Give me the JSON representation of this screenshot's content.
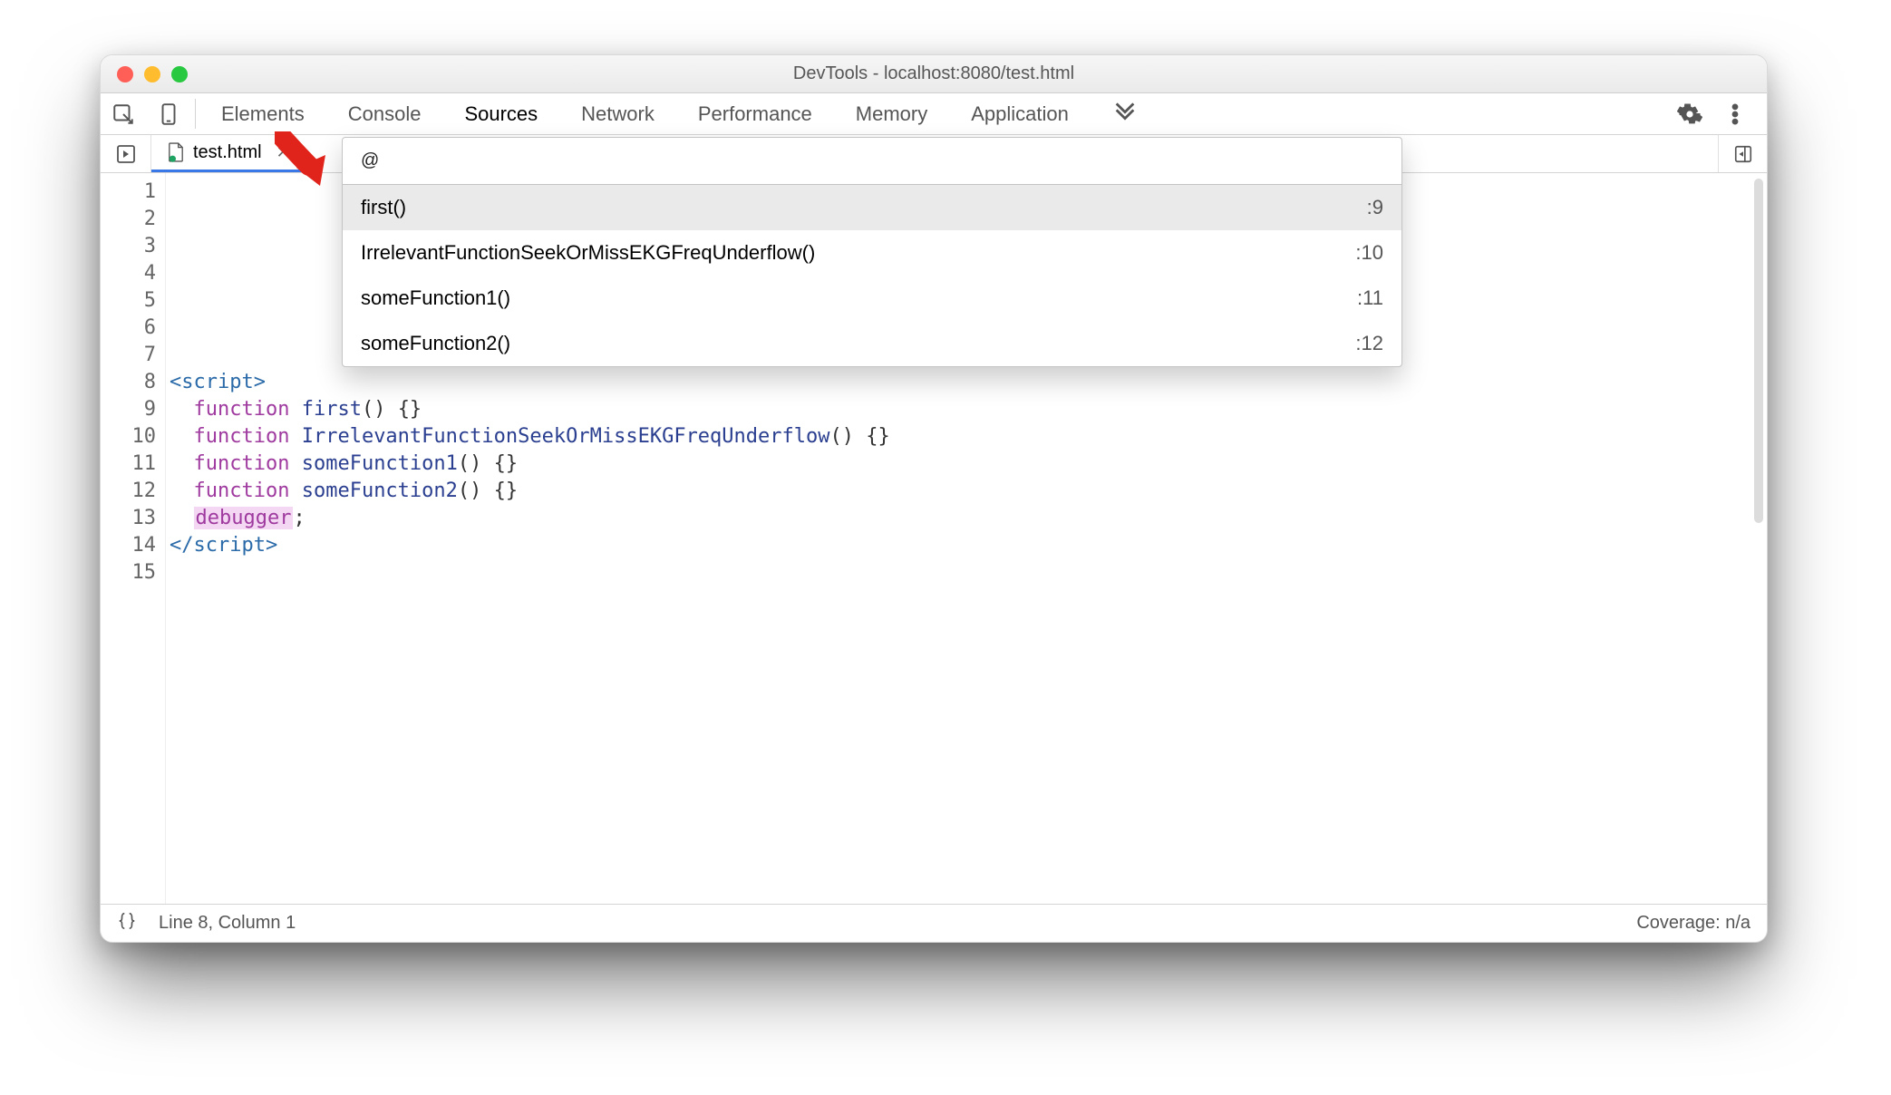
{
  "window": {
    "title": "DevTools - localhost:8080/test.html"
  },
  "tabs": {
    "items": [
      "Elements",
      "Console",
      "Sources",
      "Network",
      "Performance",
      "Memory",
      "Application"
    ],
    "active": "Sources"
  },
  "file_tab": {
    "name": "test.html"
  },
  "popup": {
    "query": "@",
    "rows": [
      {
        "label": "first()",
        "line": ":9"
      },
      {
        "label": "IrrelevantFunctionSeekOrMissEKGFreqUnderflow()",
        "line": ":10"
      },
      {
        "label": "someFunction1()",
        "line": ":11"
      },
      {
        "label": "someFunction2()",
        "line": ":12"
      }
    ],
    "selectedIndex": 0
  },
  "code": {
    "lines": [
      {
        "n": 1,
        "tokens": []
      },
      {
        "n": 2,
        "tokens": []
      },
      {
        "n": 3,
        "tokens": []
      },
      {
        "n": 4,
        "tokens": []
      },
      {
        "n": 5,
        "tokens": []
      },
      {
        "n": 6,
        "tokens": []
      },
      {
        "n": 7,
        "tokens": []
      },
      {
        "n": 8,
        "tokens": [
          {
            "t": "<script>",
            "c": "tag"
          }
        ]
      },
      {
        "n": 9,
        "tokens": [
          {
            "t": "  ",
            "c": ""
          },
          {
            "t": "function",
            "c": "kw"
          },
          {
            "t": " ",
            "c": ""
          },
          {
            "t": "first",
            "c": "fn"
          },
          {
            "t": "() {}",
            "c": "punc"
          }
        ]
      },
      {
        "n": 10,
        "tokens": [
          {
            "t": "  ",
            "c": ""
          },
          {
            "t": "function",
            "c": "kw"
          },
          {
            "t": " ",
            "c": ""
          },
          {
            "t": "IrrelevantFunctionSeekOrMissEKGFreqUnderflow",
            "c": "fn"
          },
          {
            "t": "() {}",
            "c": "punc"
          }
        ]
      },
      {
        "n": 11,
        "tokens": [
          {
            "t": "  ",
            "c": ""
          },
          {
            "t": "function",
            "c": "kw"
          },
          {
            "t": " ",
            "c": ""
          },
          {
            "t": "someFunction1",
            "c": "fn"
          },
          {
            "t": "() {}",
            "c": "punc"
          }
        ]
      },
      {
        "n": 12,
        "tokens": [
          {
            "t": "  ",
            "c": ""
          },
          {
            "t": "function",
            "c": "kw"
          },
          {
            "t": " ",
            "c": ""
          },
          {
            "t": "someFunction2",
            "c": "fn"
          },
          {
            "t": "() {}",
            "c": "punc"
          }
        ]
      },
      {
        "n": 13,
        "tokens": [
          {
            "t": "  ",
            "c": ""
          },
          {
            "t": "debugger",
            "c": "dbg"
          },
          {
            "t": ";",
            "c": "punc"
          }
        ]
      },
      {
        "n": 14,
        "tokens": [
          {
            "t": "</script>",
            "c": "tag"
          }
        ]
      },
      {
        "n": 15,
        "tokens": []
      }
    ]
  },
  "status": {
    "cursor": "Line 8, Column 1",
    "coverage": "Coverage: n/a"
  }
}
